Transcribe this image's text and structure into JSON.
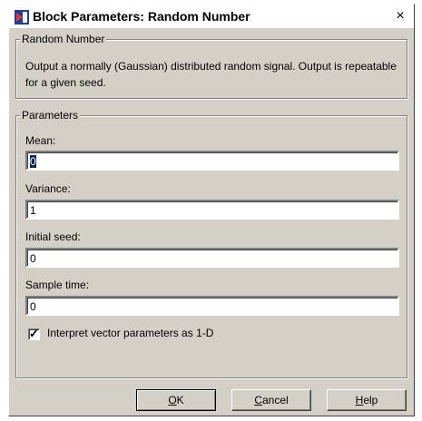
{
  "window": {
    "title": "Block Parameters: Random Number",
    "close_glyph": "×"
  },
  "block_group": {
    "legend": "Random Number",
    "description": "Output a normally (Gaussian) distributed random signal.  Output is repeatable for a given seed."
  },
  "params_group": {
    "legend": "Parameters",
    "fields": [
      {
        "label": "Mean:",
        "value": "0"
      },
      {
        "label": "Variance:",
        "value": "1"
      },
      {
        "label": "Initial seed:",
        "value": "0"
      },
      {
        "label": "Sample time:",
        "value": "0"
      }
    ],
    "checkbox": {
      "label": "Interpret vector parameters as 1-D",
      "checked": true
    }
  },
  "buttons": {
    "ok": {
      "mnemonic": "O",
      "rest": "K"
    },
    "cancel": {
      "mnemonic": "C",
      "rest": "ancel"
    },
    "help": {
      "mnemonic": "H",
      "rest": "elp"
    }
  },
  "colors": {
    "dialog_bg": "#d4d0c8",
    "selection": "#0a246a"
  },
  "icons": {
    "app": "simulink-block-icon",
    "close": "close-icon"
  }
}
